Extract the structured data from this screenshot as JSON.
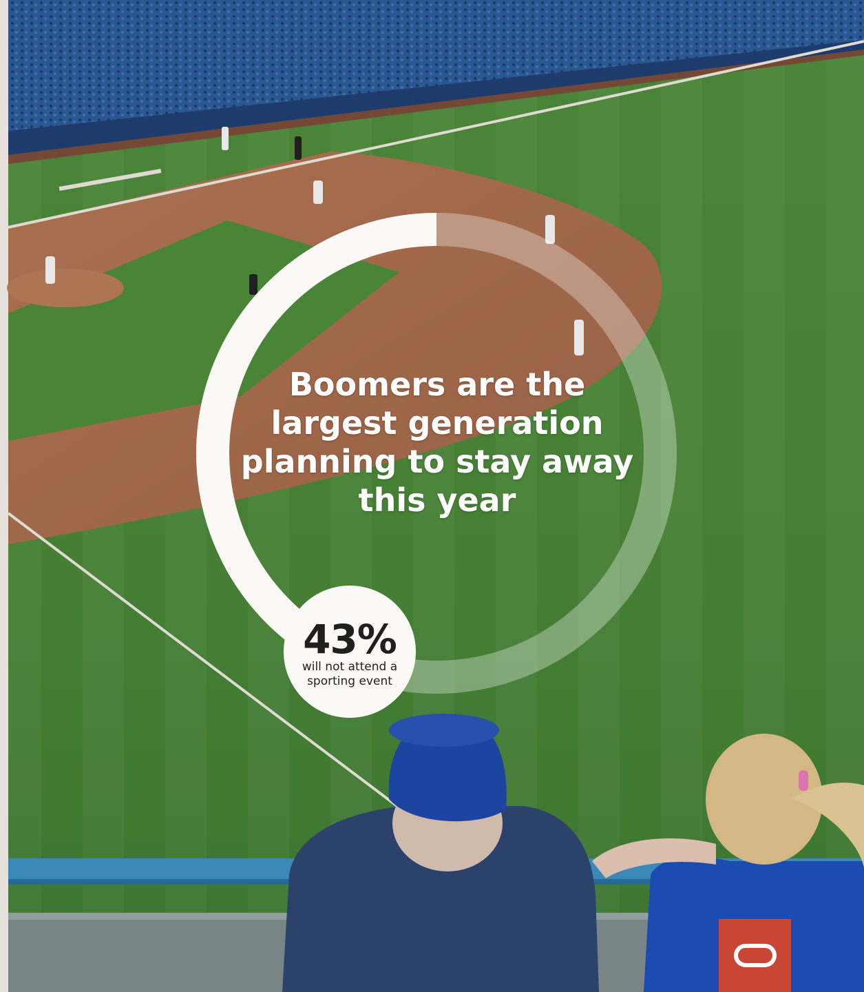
{
  "headline": "Boomers are the largest generation planning to stay away this year",
  "stat": {
    "value": "43%",
    "caption": "will not attend a sporting event",
    "fraction": 0.43
  },
  "colors": {
    "accent": "#c74634",
    "ring": "#fbf9f6",
    "text_dark": "#1f1f1f"
  },
  "icons": {
    "brand_logo": "oracle-logo-icon"
  }
}
